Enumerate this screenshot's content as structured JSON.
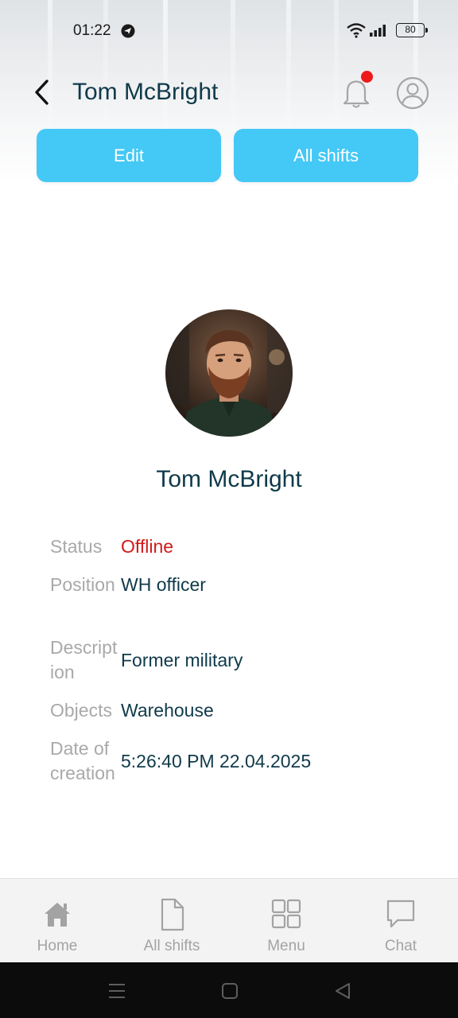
{
  "status_bar": {
    "time": "01:22",
    "battery": "80"
  },
  "header": {
    "title": "Tom McBright",
    "notification_indicator_color": "#ee1a1a",
    "icons": [
      "back-arrow-icon",
      "bell-icon",
      "user-icon"
    ]
  },
  "actions": {
    "edit_label": "Edit",
    "all_shifts_label": "All shifts",
    "button_color": "#44c8f5"
  },
  "profile": {
    "name": "Tom McBright",
    "details": [
      {
        "label": "Status",
        "value": "Offline"
      },
      {
        "label": "Position",
        "value": "WH officer"
      },
      {
        "label": "Description",
        "value": "Former military"
      },
      {
        "label": "Objects",
        "value": "Warehouse"
      },
      {
        "label": "Date of creation",
        "value": "5:26:40 PM 22.04.2025"
      }
    ],
    "status_color": "#d21919"
  },
  "bottom_nav": {
    "items": [
      {
        "label": "Home",
        "icon": "home-icon"
      },
      {
        "label": "All shifts",
        "icon": "document-icon"
      },
      {
        "label": "Menu",
        "icon": "grid-icon"
      },
      {
        "label": "Chat",
        "icon": "chat-icon"
      }
    ]
  },
  "system_nav": {
    "icons": [
      "recent-apps-icon",
      "home-button-icon",
      "back-button-icon"
    ]
  }
}
